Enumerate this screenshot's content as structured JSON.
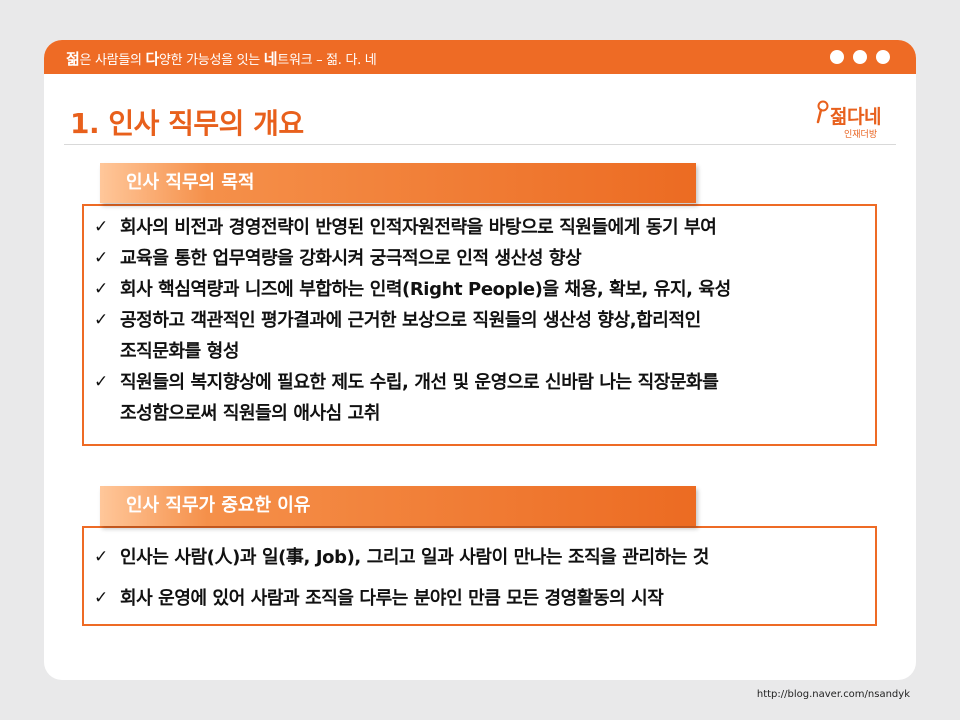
{
  "header": {
    "tagline_parts": [
      {
        "text": "젊",
        "bold": true
      },
      {
        "text": "은 사람들의 ",
        "bold": false
      },
      {
        "text": "다",
        "bold": true
      },
      {
        "text": "양한 가능성을 잇는 ",
        "bold": false
      },
      {
        "text": "네",
        "bold": true
      },
      {
        "text": "트워크 – 젊. 다. 네",
        "bold": false
      }
    ],
    "window_dots": 3
  },
  "page": {
    "title": "1. 인사 직무의 개요"
  },
  "logo": {
    "name": "젊다네",
    "subtitle": "인재더방",
    "icon": "microphone-icon"
  },
  "sections": [
    {
      "heading": "인사 직무의 목적",
      "items": [
        {
          "mark": "✓",
          "text": "회사의 비전과 경영전략이 반영된 인적자원전략을 바탕으로 직원들에게 동기 부여"
        },
        {
          "mark": "✓",
          "text": "교육을 통한 업무역량을 강화시켜 궁극적으로 인적 생산성 향상"
        },
        {
          "mark": "✓",
          "text": "회사 핵심역량과 니즈에 부합하는 인력(Right People)을 채용, 확보, 유지, 육성"
        },
        {
          "mark": "✓",
          "text": "공정하고 객관적인 평가결과에 근거한 보상으로 직원들의 생산성 향상,합리적인\n조직문화를 형성"
        },
        {
          "mark": "✓",
          "text": "직원들의 복지향상에 필요한 제도 수립, 개선 및 운영으로 신바람 나는 직장문화를\n조성함으로써 직원들의 애사심 고취"
        }
      ]
    },
    {
      "heading": "인사 직무가 중요한 이유",
      "items": [
        {
          "mark": "✓",
          "text": "인사는 사람(人)과 일(事, Job), 그리고 일과 사람이 만나는 조직을 관리하는 것"
        },
        {
          "mark": "✓",
          "text": "회사 운영에 있어 사람과 조직을 다루는 분야인 만큼 모든 경영활동의 시작"
        }
      ]
    }
  ],
  "footer": {
    "url": "http://blog.naver.com/nsandyk"
  },
  "colors": {
    "accent": "#ee6b25",
    "title": "#e8601c",
    "background": "#e9e9ea",
    "card": "#ffffff"
  }
}
